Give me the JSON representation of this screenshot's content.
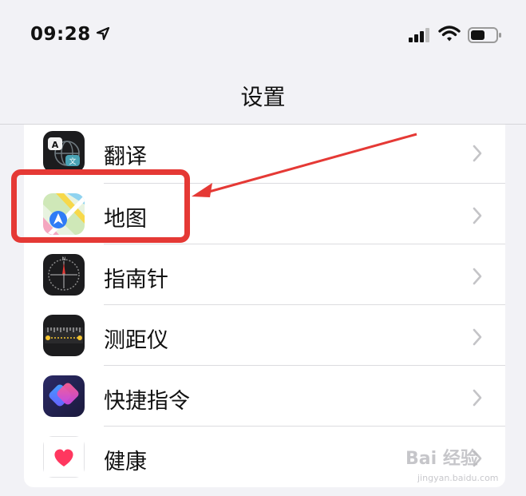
{
  "status_bar": {
    "time": "09:28"
  },
  "nav": {
    "title": "设置"
  },
  "rows": [
    {
      "label": "翻译",
      "icon": "translate-icon"
    },
    {
      "label": "地图",
      "icon": "maps-icon"
    },
    {
      "label": "指南针",
      "icon": "compass-icon"
    },
    {
      "label": "测距仪",
      "icon": "measure-icon"
    },
    {
      "label": "快捷指令",
      "icon": "shortcuts-icon"
    },
    {
      "label": "健康",
      "icon": "health-icon"
    }
  ],
  "annotation": {
    "color": "#e53935"
  },
  "watermark": {
    "text": "Bai 经验",
    "sub": "jingyan.baidu.com"
  }
}
